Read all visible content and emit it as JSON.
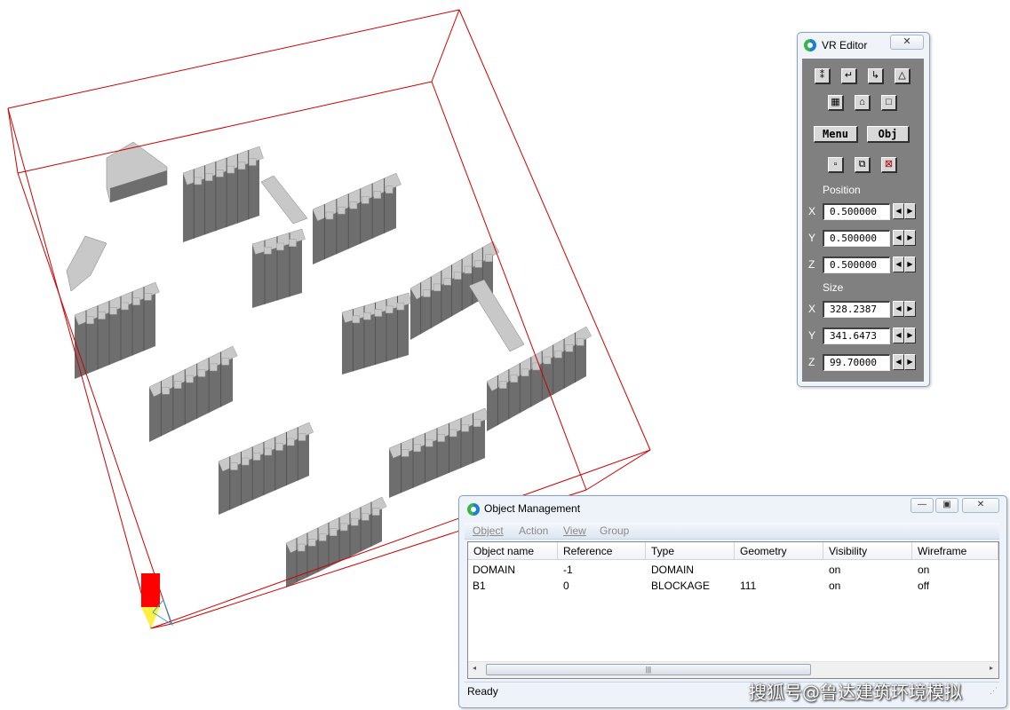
{
  "scene": {
    "domain_box_color": "#cc0000",
    "building_face_color": "#6e6e6e",
    "building_top_color": "#c8c8c8",
    "origin_marker_color": "#ff0000"
  },
  "vr_editor": {
    "title": "VR Editor",
    "close_glyph": "✕",
    "toolbar_row1": [
      {
        "icon": "xyz-axes-icon",
        "glyph": "⁑"
      },
      {
        "icon": "undo-icon",
        "glyph": "↵"
      },
      {
        "icon": "redo-icon",
        "glyph": "↳"
      },
      {
        "icon": "compass-icon",
        "glyph": "△"
      }
    ],
    "toolbar_row2": [
      {
        "icon": "grid-icon",
        "glyph": "▦"
      },
      {
        "icon": "trash-icon",
        "glyph": "⌂"
      },
      {
        "icon": "box-icon",
        "glyph": "□"
      }
    ],
    "menu_label": "Menu",
    "obj_label": "Obj",
    "toolbar_row3": [
      {
        "icon": "move-object-icon",
        "glyph": "▫"
      },
      {
        "icon": "copy-object-icon",
        "glyph": "⧉"
      },
      {
        "icon": "delete-object-icon",
        "glyph": "⊠"
      }
    ],
    "position_label": "Position",
    "size_label": "Size",
    "position": {
      "x": "0.500000",
      "y": "0.500000",
      "z": "0.500000"
    },
    "size": {
      "x": "328.2387",
      "y": "341.6473",
      "z": "99.70000"
    },
    "axis_x": "X",
    "axis_y": "Y",
    "axis_z": "Z",
    "spin_left": "◀",
    "spin_right": "▶"
  },
  "object_management": {
    "title": "Object Management",
    "minimize_glyph": "—",
    "maximize_glyph": "▣",
    "close_glyph": "✕",
    "menu": [
      "Object",
      "Action",
      "View",
      "Group"
    ],
    "columns": [
      "Object name",
      "Reference",
      "Type",
      "Geometry",
      "Visibility",
      "Wireframe"
    ],
    "rows": [
      [
        "DOMAIN",
        "-1",
        "DOMAIN",
        "",
        "on",
        "on"
      ],
      [
        "B1",
        "0",
        "BLOCKAGE",
        "111",
        "on",
        "off"
      ]
    ],
    "scroll_left": "◂",
    "scroll_right": "▸",
    "thumb_grip": "|||",
    "status": "Ready",
    "resize_grip": "⋰"
  },
  "watermark": "搜狐号@鲁达建筑环境模拟"
}
